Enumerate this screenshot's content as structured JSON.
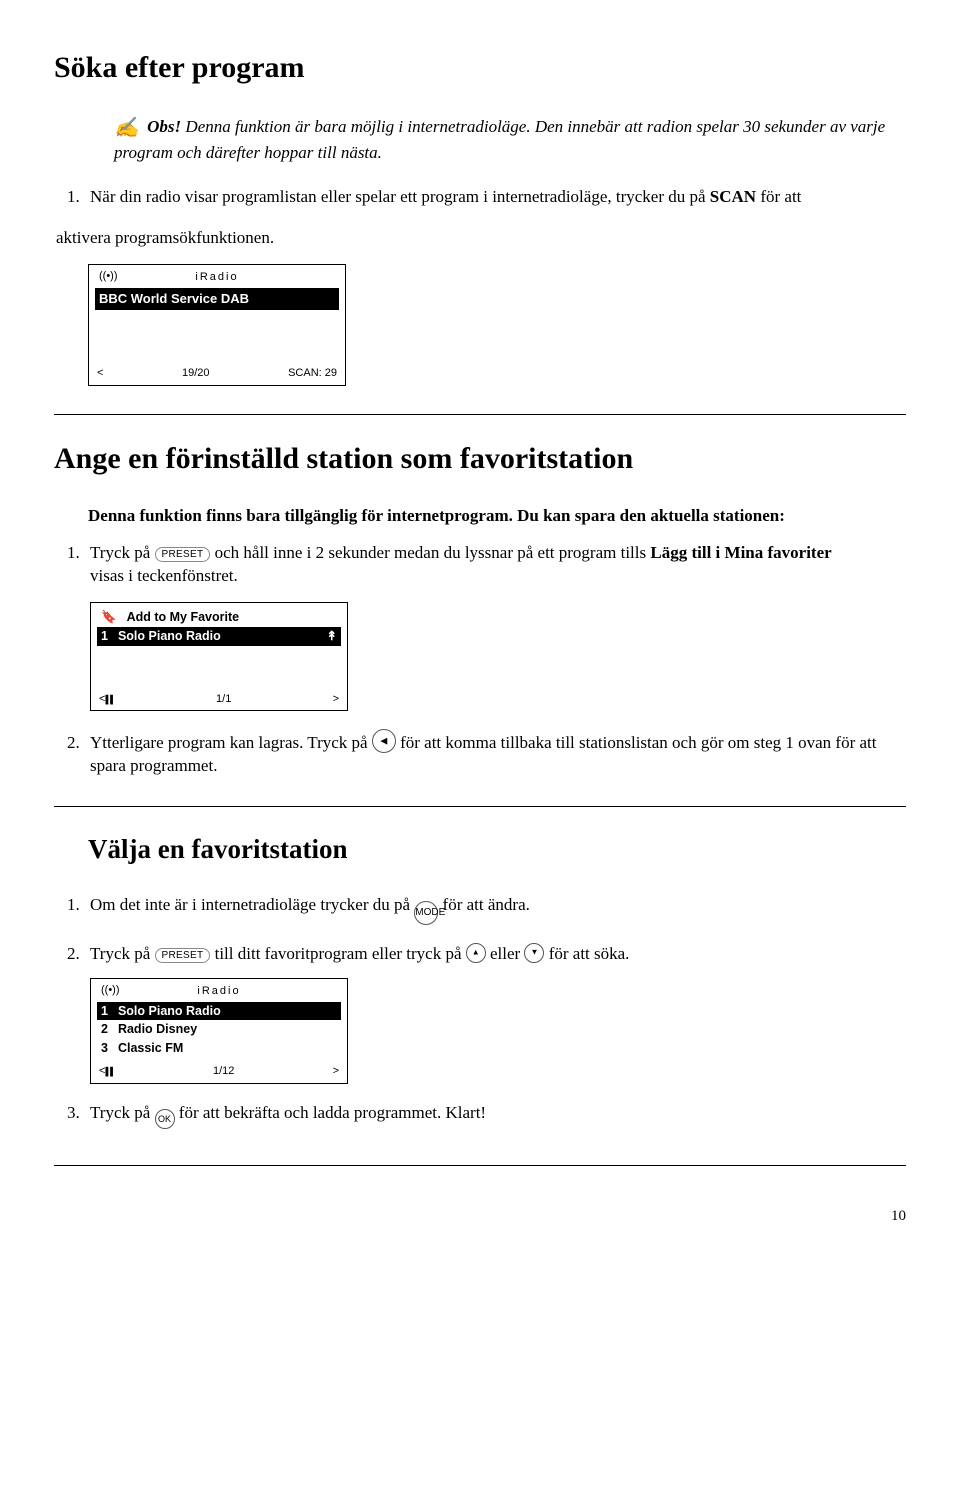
{
  "section1": {
    "title": "Söka efter program",
    "note_prefix": "Obs!",
    "note": "Denna funktion är bara möjlig i internetradioläge. Den innebär att radion spelar 30 sekunder av varje program och därefter hoppar till nästa.",
    "step1_a": "När din radio visar programlistan eller spelar ett program i internetradioläge, trycker du på ",
    "step1_bold": "SCAN",
    "step1_b": " för att",
    "step1_c": "aktivera programsökfunktionen.",
    "lcd": {
      "brand": "iRadio",
      "line1": "BBC World Service DAB",
      "bl": "<",
      "bm": "19/20",
      "br": "SCAN: 29"
    }
  },
  "section2": {
    "title": "Ange en förinställd station som favoritstation",
    "intro": "Denna funktion finns bara tillgänglig för internetprogram. Du kan spara den aktuella stationen:",
    "step1_a": "Tryck på ",
    "btn_preset": "PRESET",
    "step1_b": " och håll inne i 2 sekunder medan du lyssnar på ett program tills ",
    "step1_bold": "Lägg till i Mina favoriter",
    "step1_c": "visas i teckenfönstret.",
    "lcd": {
      "top": "Add to My Favorite",
      "row1_num": "1",
      "row1_txt": "Solo Piano Radio",
      "bl": "<",
      "bm": "1/1",
      "br": ">"
    },
    "step2_a": "Ytterligare program kan lagras. Tryck på ",
    "step2_b": " för att komma tillbaka till stationslistan och gör om steg 1 ovan för att spara programmet."
  },
  "section3": {
    "title": "Välja en favoritstation",
    "step1_a": "Om det inte är i internetradioläge trycker du på ",
    "btn_mode": "MODE",
    "step1_b": " för att ändra.",
    "step2_a": "Tryck på ",
    "btn_preset": "PRESET",
    "step2_b": " till ditt favoritprogram eller tryck på ",
    "step2_c": " eller ",
    "step2_d": " för att söka.",
    "lcd": {
      "brand": "iRadio",
      "r1n": "1",
      "r1t": "Solo Piano Radio",
      "r2n": "2",
      "r2t": "Radio Disney",
      "r3n": "3",
      "r3t": "Classic FM",
      "bl": "<",
      "bm": "1/12",
      "br": ">"
    },
    "step3_a": "Tryck på ",
    "btn_ok": "OK",
    "step3_b": " för att bekräfta och ladda programmet. Klart!"
  },
  "pagenum": "10"
}
